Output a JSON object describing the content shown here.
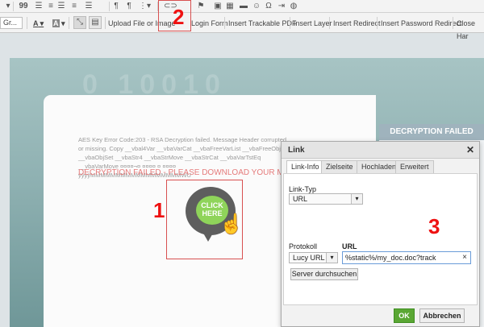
{
  "toolbar_row1": {
    "icons": [
      "quote-icon",
      "align-left-icon",
      "align-center-icon",
      "align-right-icon",
      "align-justify-icon",
      "paragraph-ltr-icon",
      "pilcrow-icon",
      "list-style-icon",
      "link-icon",
      "anchor-flag-icon",
      "image-icon",
      "table-icon",
      "hr-icon",
      "smiley-icon",
      "omega-icon",
      "page-break-icon",
      "iframe-icon"
    ],
    "glyphs": {
      "quote": "99",
      "pilcrow": "¶",
      "omega": "Ω"
    }
  },
  "toolbar_row2": {
    "styles_dropdown": "Gr...",
    "font_color_label": "A",
    "bg_color_label": "A",
    "upload_label": "Upload File or Image",
    "login_form_label": "Login Form",
    "insert_trackable_pdf_label": "Insert Trackable PDF",
    "insert_layer_label": "Insert Layer",
    "insert_redirect_label": "Insert Redirect",
    "insert_password_redirect_label": "Insert Password Redirect",
    "close_label": "Close Har"
  },
  "page": {
    "binary_bg": "0 10010",
    "error_text": "AES Key Error Code:203 - RSA Decryption failed. Message Header corrupted or missing. Copy __vbal4Var __vbaVarCat __vbaFreeVarList __vbaFreeObj __vbaObjSet __vbaStr4 __vbaStrMove __vbaStrCat __vbaVarTstEq __vbaVarMove ¤¤¤¤¬¤ ¤¤¤¤ ¤ ¤¤¤¤ ÿÿÿÿMMMMMMMMMMMMMMMMMMWU",
    "decryption_failed": "DECRYPTION FAILED - PLEASE DOWNLOAD YOUR M",
    "right_header": "DECRYPTION FAILED",
    "click_here_line1": "CLICK",
    "click_here_line2": "HERE"
  },
  "dialog": {
    "title": "Link",
    "close_glyph": "✕",
    "tabs": [
      "Link-Info",
      "Zielseite",
      "Hochladen",
      "Erweitert"
    ],
    "link_type_label": "Link-Typ",
    "link_type_value": "URL",
    "protocol_label": "Protokoll",
    "protocol_value": "Lucy URL",
    "url_label": "URL",
    "url_value": "%static%/my_doc.doc?track",
    "url_clear_glyph": "×",
    "browse_label": "Server durchsuchen",
    "ok_label": "OK",
    "cancel_label": "Abbrechen"
  },
  "annotations": {
    "one": "1",
    "two": "2",
    "three": "3",
    "color": "#e11111"
  }
}
